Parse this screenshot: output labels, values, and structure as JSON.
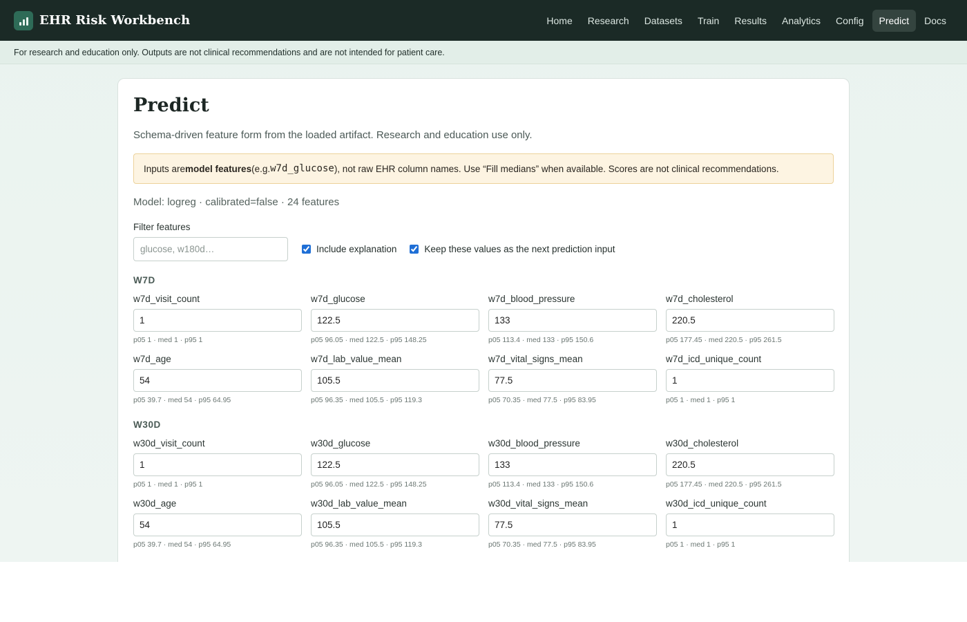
{
  "app": {
    "title": "EHR Risk Workbench"
  },
  "nav": [
    "Home",
    "Research",
    "Datasets",
    "Train",
    "Results",
    "Analytics",
    "Config",
    "Predict",
    "Docs"
  ],
  "nav_active": "Predict",
  "disclaimer": "For research and education only. Outputs are not clinical recommendations and are not intended for patient care.",
  "page": {
    "title": "Predict",
    "subtitle": "Schema-driven feature form from the loaded artifact. Research and education use only.",
    "notice": {
      "part1": "Inputs are ",
      "bold": "model features",
      "part2": " (e.g. ",
      "code": "w7d_glucose",
      "part3": "), not raw EHR column names. Use “Fill medians” when available. Scores are not clinical recommendations."
    },
    "model_line": "Model: logreg · calibrated=false · 24 features"
  },
  "filter": {
    "label": "Filter features",
    "placeholder": "glucose, w180d…",
    "include_explanation_label": "Include explanation",
    "include_explanation_checked": true,
    "keep_values_label": "Keep these values as the next prediction input",
    "keep_values_checked": true
  },
  "groups": [
    {
      "title": "W7D",
      "fields": [
        {
          "name": "w7d_visit_count",
          "value": "1",
          "hint": "p05 1 · med 1 · p95 1"
        },
        {
          "name": "w7d_glucose",
          "value": "122.5",
          "hint": "p05 96.05 · med 122.5 · p95 148.25"
        },
        {
          "name": "w7d_blood_pressure",
          "value": "133",
          "hint": "p05 113.4 · med 133 · p95 150.6"
        },
        {
          "name": "w7d_cholesterol",
          "value": "220.5",
          "hint": "p05 177.45 · med 220.5 · p95 261.5"
        },
        {
          "name": "w7d_age",
          "value": "54",
          "hint": "p05 39.7 · med 54 · p95 64.95"
        },
        {
          "name": "w7d_lab_value_mean",
          "value": "105.5",
          "hint": "p05 96.35 · med 105.5 · p95 119.3"
        },
        {
          "name": "w7d_vital_signs_mean",
          "value": "77.5",
          "hint": "p05 70.35 · med 77.5 · p95 83.95"
        },
        {
          "name": "w7d_icd_unique_count",
          "value": "1",
          "hint": "p05 1 · med 1 · p95 1"
        }
      ]
    },
    {
      "title": "W30D",
      "fields": [
        {
          "name": "w30d_visit_count",
          "value": "1",
          "hint": "p05 1 · med 1 · p95 1"
        },
        {
          "name": "w30d_glucose",
          "value": "122.5",
          "hint": "p05 96.05 · med 122.5 · p95 148.25"
        },
        {
          "name": "w30d_blood_pressure",
          "value": "133",
          "hint": "p05 113.4 · med 133 · p95 150.6"
        },
        {
          "name": "w30d_cholesterol",
          "value": "220.5",
          "hint": "p05 177.45 · med 220.5 · p95 261.5"
        },
        {
          "name": "w30d_age",
          "value": "54",
          "hint": "p05 39.7 · med 54 · p95 64.95"
        },
        {
          "name": "w30d_lab_value_mean",
          "value": "105.5",
          "hint": "p05 96.35 · med 105.5 · p95 119.3"
        },
        {
          "name": "w30d_vital_signs_mean",
          "value": "77.5",
          "hint": "p05 70.35 · med 77.5 · p95 83.95"
        },
        {
          "name": "w30d_icd_unique_count",
          "value": "1",
          "hint": "p05 1 · med 1 · p95 1"
        }
      ]
    }
  ]
}
